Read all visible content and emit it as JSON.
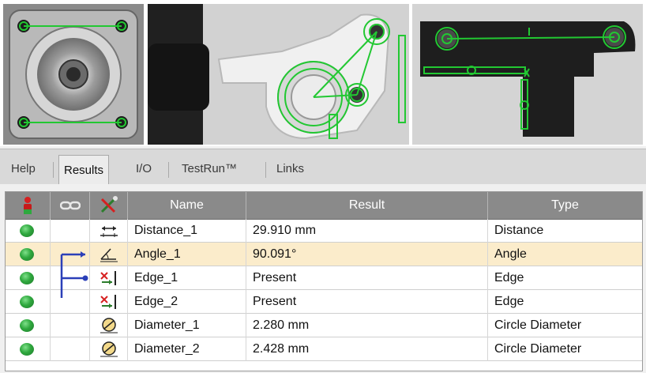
{
  "tabs": [
    "Help",
    "Results",
    "I/O",
    "TestRun™",
    "Links"
  ],
  "active_tab": "Results",
  "table": {
    "columns": [
      "",
      "",
      "",
      "Name",
      "Result",
      "Type"
    ],
    "header_icons": [
      "status-icon",
      "link-icon",
      "tools-icon"
    ],
    "rows": [
      {
        "name": "Distance_1",
        "result": "29.910 mm",
        "type": "Distance",
        "icon": "distance-icon",
        "status": "pass"
      },
      {
        "name": "Angle_1",
        "result": "90.091°",
        "type": "Angle",
        "icon": "angle-icon",
        "status": "pass",
        "selected": true
      },
      {
        "name": "Edge_1",
        "result": "Present",
        "type": "Edge",
        "icon": "edge-icon",
        "status": "pass"
      },
      {
        "name": "Edge_2",
        "result": "Present",
        "type": "Edge",
        "icon": "edge-icon",
        "status": "pass"
      },
      {
        "name": "Diameter_1",
        "result": "2.280 mm",
        "type": "Circle Diameter",
        "icon": "diameter-icon",
        "status": "pass"
      },
      {
        "name": "Diameter_2",
        "result": "2.428 mm",
        "type": "Circle Diameter",
        "icon": "diameter-icon",
        "status": "pass"
      }
    ]
  },
  "colors": {
    "overlay": "#22c832",
    "status_green": "#2fa83e",
    "header_bg": "#8a8a8a",
    "selected_row": "#fbeccb",
    "link_line": "#2b3fb8"
  },
  "images": [
    "stepper-motor-camera-view",
    "bracket-part-camera-view",
    "t-plate-camera-view"
  ]
}
